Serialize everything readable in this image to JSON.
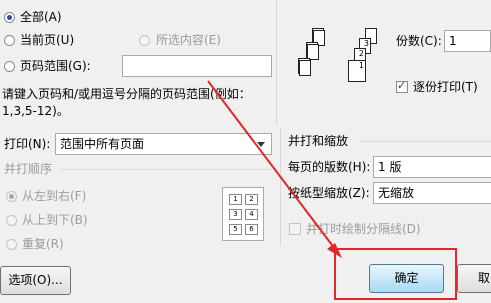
{
  "page_range": {
    "all_label": "全部(A)",
    "current_label": "当前页(U)",
    "selection_label": "所选内容(E)",
    "pages_label": "页码范围(G):",
    "pages_value": "",
    "hint": "请键入页码和/或用逗号分隔的页码范围(例如：",
    "hint_example": "1,3,5-12)。"
  },
  "copies": {
    "label": "份数(C):",
    "value": "1",
    "collate_label": "逐份打印(T)",
    "collate_checked": true,
    "stack_pages": [
      "1",
      "2",
      "3"
    ]
  },
  "print_what": {
    "label": "打印(N):",
    "selected": "范围中所有页面"
  },
  "print_order": {
    "title": "并打顺序",
    "options": [
      "从左到右(F)",
      "从上到下(B)",
      "重复(R)"
    ],
    "selected_index": 0,
    "grid_numbers": [
      "1",
      "2",
      "3",
      "4",
      "5",
      "6"
    ]
  },
  "zoom": {
    "title": "并打和缩放",
    "pages_per_sheet_label": "每页的版数(H):",
    "pages_per_sheet_value": "1 版",
    "scale_label": "按纸型缩放(Z):",
    "scale_value": "无缩放",
    "draw_borders_label": "并打时绘制分隔线(D)"
  },
  "buttons": {
    "options": "选项(O)...",
    "ok": "确定",
    "cancel": "取"
  },
  "colors": {
    "annotation_red": "#e2262a",
    "accent_blue": "#3c7fb1"
  }
}
